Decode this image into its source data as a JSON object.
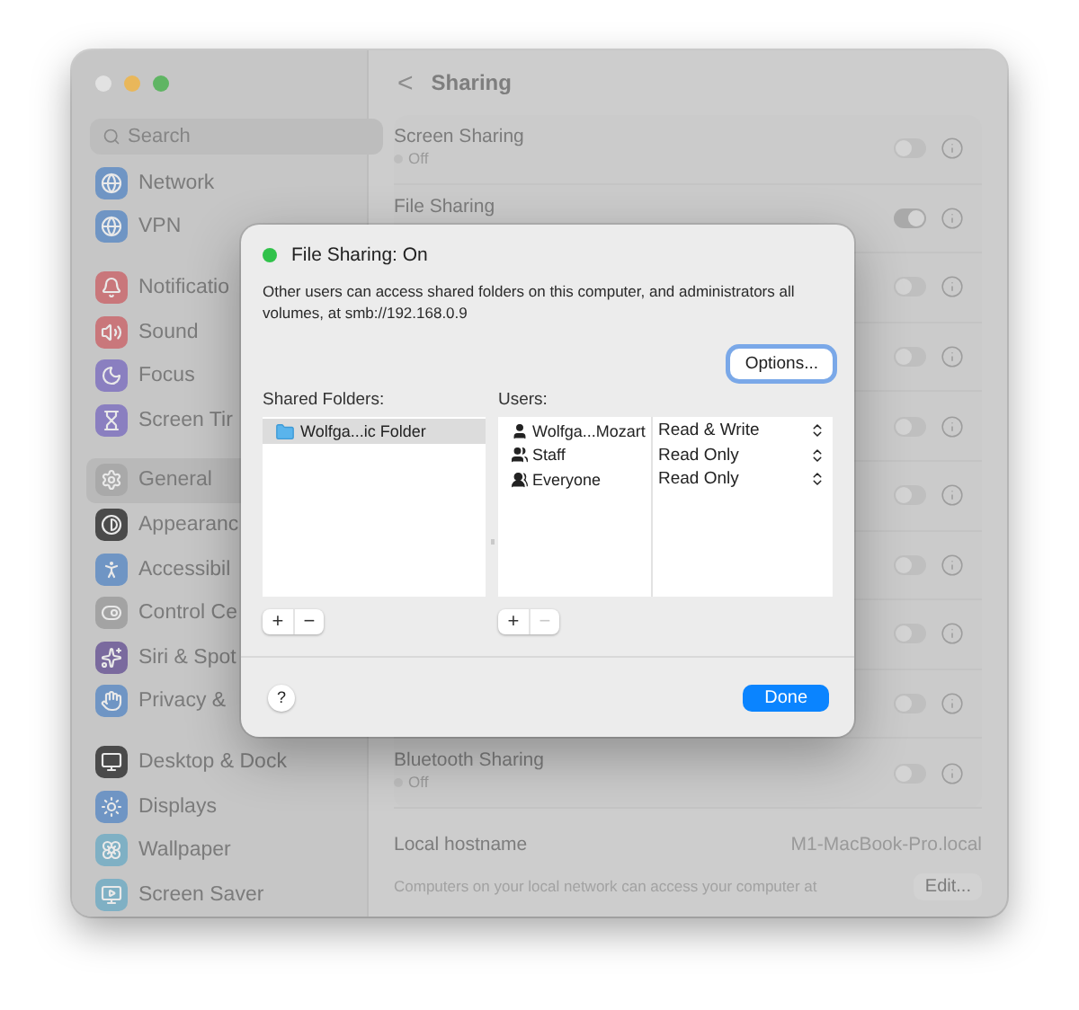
{
  "sidebar": {
    "search": {
      "placeholder": "Search"
    },
    "groups": [
      [
        {
          "label": "Network",
          "color": "#6f95c4",
          "selected": false
        },
        {
          "label": "VPN",
          "color": "#6f95c4",
          "selected": false
        }
      ],
      [
        {
          "label": "Notificatio",
          "color": "#c9777b",
          "selected": false
        },
        {
          "label": "Sound",
          "color": "#c9777b",
          "selected": false
        },
        {
          "label": "Focus",
          "color": "#8a7fc0",
          "selected": false
        },
        {
          "label": "Screen Tir",
          "color": "#8a7fc0",
          "selected": false
        }
      ],
      [
        {
          "label": "General",
          "color": "#a9a9a9",
          "selected": true
        },
        {
          "label": "Appearanc",
          "color": "#4a4a4a",
          "selected": false
        },
        {
          "label": "Accessibil",
          "color": "#6f95c4",
          "selected": false
        },
        {
          "label": "Control Ce",
          "color": "#a3a3a3",
          "selected": false
        },
        {
          "label": "Siri & Spot",
          "color": "#7a6a9e",
          "selected": false
        },
        {
          "label": "Privacy &",
          "color": "#6f95c4",
          "selected": false
        }
      ],
      [
        {
          "label": "Desktop & Dock",
          "color": "#4a4a4a",
          "selected": false
        },
        {
          "label": "Displays",
          "color": "#6f95c4",
          "selected": false
        },
        {
          "label": "Wallpaper",
          "color": "#7fb0c4",
          "selected": false
        },
        {
          "label": "Screen Saver",
          "color": "#7fb0c4",
          "selected": false
        }
      ]
    ]
  },
  "header": {
    "back": "<",
    "title": "Sharing"
  },
  "services": [
    {
      "name": "Screen Sharing",
      "status": "Off",
      "on": false
    },
    {
      "name": "File Sharing",
      "on": true
    },
    {
      "on": false
    },
    {
      "on": false
    },
    {
      "on": false
    },
    {
      "on": false
    },
    {
      "on": false
    },
    {
      "on": false
    },
    {
      "on": false
    },
    {
      "name": "Bluetooth Sharing",
      "status": "Off",
      "on": false
    }
  ],
  "hostname": {
    "label": "Local hostname",
    "value": "M1-MacBook-Pro.local",
    "note": "Computers on your local network can access your computer at",
    "button": "Edit..."
  },
  "dialog": {
    "status": {
      "text": "File Sharing: On",
      "on": true
    },
    "description": "Other users can access shared folders on this computer, and administrators all volumes, at smb://192.168.0.9",
    "options_button": "Options...",
    "folders": {
      "label": "Shared Folders:",
      "items": [
        {
          "name": "Wolfga...ic Folder",
          "selected": true
        }
      ],
      "buttons": [
        {
          "label": "+",
          "disabled": false
        },
        {
          "label": "−",
          "disabled": false
        }
      ]
    },
    "users": {
      "label": "Users:",
      "items": [
        {
          "name": "Wolfga...Mozart",
          "kind": "user",
          "permission": "Read & Write"
        },
        {
          "name": "Staff",
          "kind": "group",
          "permission": "Read Only"
        },
        {
          "name": "Everyone",
          "kind": "everyone",
          "permission": "Read Only"
        }
      ],
      "buttons": [
        {
          "label": "+",
          "disabled": false
        },
        {
          "label": "−",
          "disabled": true
        }
      ]
    },
    "help": "?",
    "done": "Done"
  }
}
